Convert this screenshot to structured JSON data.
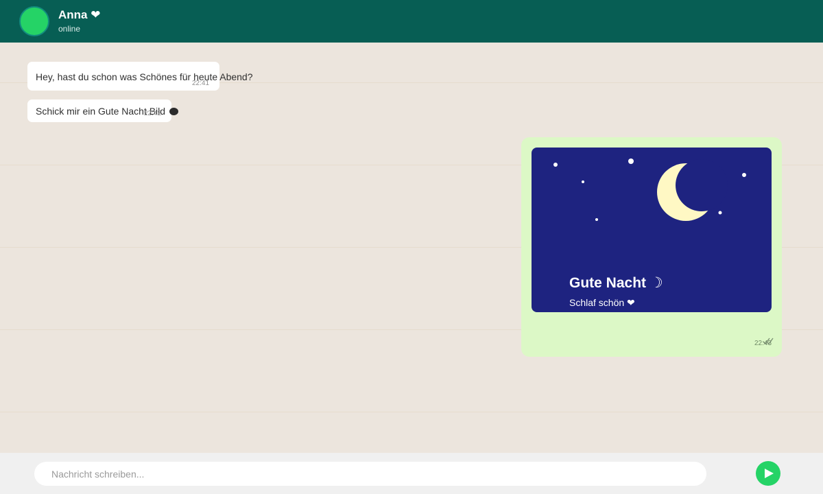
{
  "header": {
    "contact_name": "Anna ❤",
    "status": "online"
  },
  "messages": [
    {
      "direction": "incoming",
      "text": "Hey, hast du schon was Schönes für heute Abend?",
      "time": "22:41"
    },
    {
      "direction": "incoming",
      "text": "Schick mir ein Gute Nacht Bild",
      "time": "22:42"
    },
    {
      "direction": "outgoing",
      "image": {
        "title": "Gute Nacht ☽",
        "subtitle": "Schlaf schön ❤"
      },
      "time": "22:43",
      "status": "read"
    }
  ],
  "composer": {
    "placeholder": "Nachricht schreiben..."
  },
  "colors": {
    "header": "#075e54",
    "accent": "#25d366",
    "chat_background": "#ece5dd",
    "outgoing_bubble": "#dcf8c6",
    "image_background": "#1e2380",
    "moon": "#fff8c4"
  },
  "icons": {
    "send": "send-icon",
    "read_receipt": "double-check-icon",
    "emoji": "emoji-face-icon"
  }
}
